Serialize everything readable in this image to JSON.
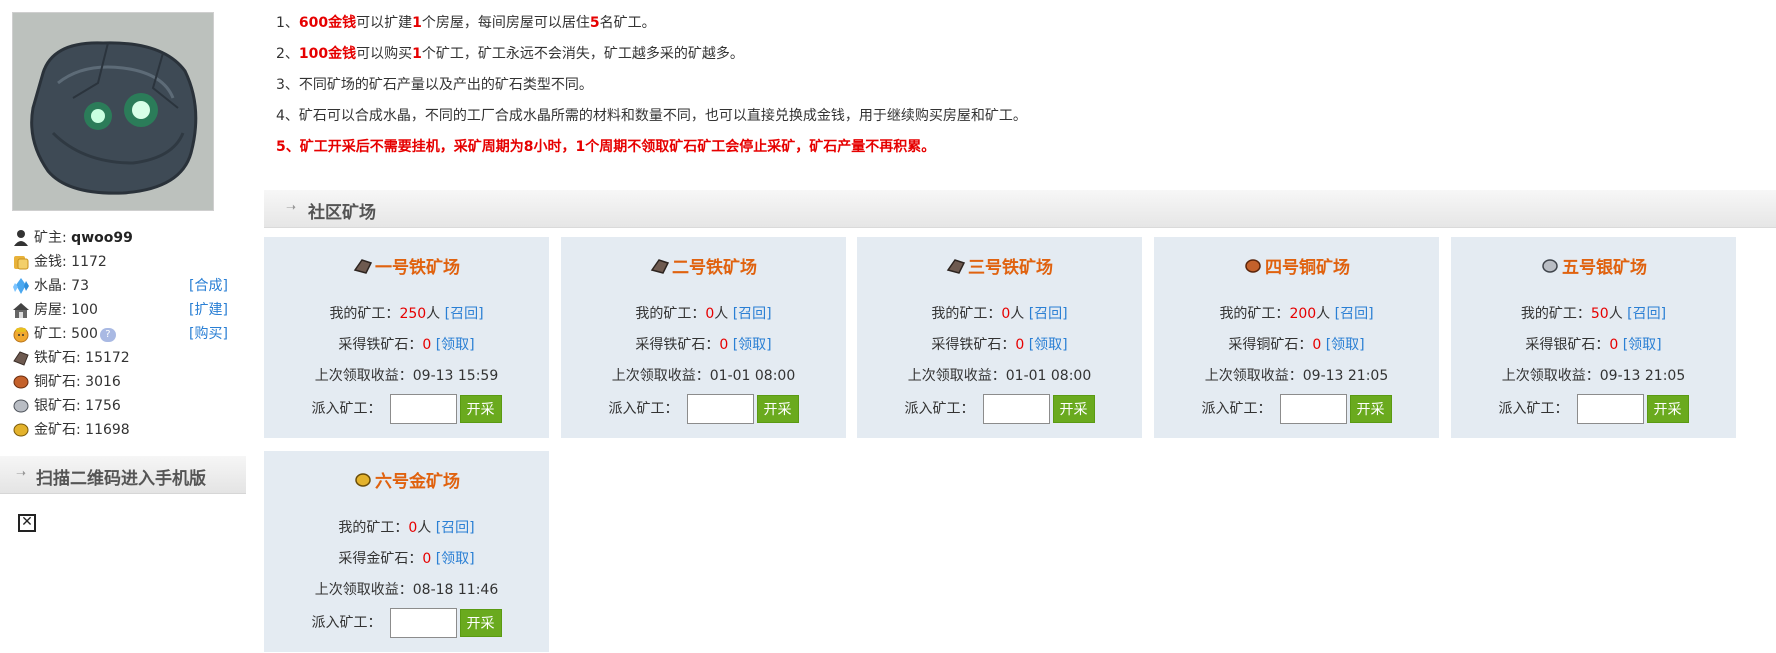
{
  "colors": {
    "accent_red": "#e60000",
    "mine_title": "#e0620f",
    "link": "#2a7fd4",
    "card_bg": "#e4ebf2",
    "start_btn": "#6aaa1e"
  },
  "sidebar": {
    "owner_label": "矿主: ",
    "owner_name": "qwoo99",
    "stats": [
      {
        "icon": "user-icon",
        "label": "矿主: qwoo99"
      },
      {
        "icon": "coins-icon",
        "label": "金钱: 1172"
      },
      {
        "icon": "crystal-icon",
        "label": "水晶: 73",
        "action": "[合成]"
      },
      {
        "icon": "house-icon",
        "label": "房屋: 100",
        "action": "[扩建]"
      },
      {
        "icon": "miner-icon",
        "label": "矿工: 500",
        "action": "[购买]"
      },
      {
        "icon": "iron-ore-icon",
        "label": "铁矿石: 15172"
      },
      {
        "icon": "copper-ore-icon",
        "label": "铜矿石: 3016"
      },
      {
        "icon": "silver-ore-icon",
        "label": "银矿石: 1756"
      },
      {
        "icon": "gold-ore-icon",
        "label": "金矿石: 11698"
      }
    ],
    "qr_title": "扫描二维码进入手机版"
  },
  "rules": {
    "r1": {
      "prefix": "1、",
      "amount": "600金钱",
      "mid": "可以扩建",
      "n1": "1",
      "mid2": "个房屋，每间房屋可以居住",
      "n2": "5",
      "suffix": "名矿工。"
    },
    "r2": {
      "prefix": "2、",
      "amount": "100金钱",
      "mid": "可以购买",
      "n1": "1",
      "suffix": "个矿工，矿工永远不会消失，矿工越多采的矿越多。"
    },
    "r3": "3、不同矿场的矿石产量以及产出的矿石类型不同。",
    "r4": "4、矿石可以合成水晶，不同的工厂合成水晶所需的材料和数量不同，也可以直接兑换成金钱，用于继续购买房屋和矿工。",
    "r5": "5、矿工开采后不需要挂机，采矿周期为8小时，1个周期不领取矿石矿工会停止采矿，矿石产量不再积累。"
  },
  "section_title": "社区矿场",
  "mine_labels": {
    "my_miners": "我的矿工：",
    "person_unit": "人",
    "recall": "[召回]",
    "collect": "[领取]",
    "last_income": "上次领取收益：",
    "assign": "派入矿工：",
    "start_btn": "开采"
  },
  "mines": [
    {
      "name": "一号铁矿场",
      "ore_icon": "iron-ore-icon",
      "miners": "250",
      "ore_label": "采得铁矿石：",
      "ore_amount": "0",
      "last_time": "09-13 15:59"
    },
    {
      "name": "二号铁矿场",
      "ore_icon": "iron-ore-icon",
      "miners": "0",
      "ore_label": "采得铁矿石：",
      "ore_amount": "0",
      "last_time": "01-01 08:00"
    },
    {
      "name": "三号铁矿场",
      "ore_icon": "iron-ore-icon",
      "miners": "0",
      "ore_label": "采得铁矿石：",
      "ore_amount": "0",
      "last_time": "01-01 08:00"
    },
    {
      "name": "四号铜矿场",
      "ore_icon": "copper-ore-icon",
      "miners": "200",
      "ore_label": "采得铜矿石：",
      "ore_amount": "0",
      "last_time": "09-13 21:05"
    },
    {
      "name": "五号银矿场",
      "ore_icon": "silver-ore-icon",
      "miners": "50",
      "ore_label": "采得银矿石：",
      "ore_amount": "0",
      "last_time": "09-13 21:05"
    },
    {
      "name": "六号金矿场",
      "ore_icon": "gold-ore-icon",
      "miners": "0",
      "ore_label": "采得金矿石：",
      "ore_amount": "0",
      "last_time": "08-18 11:46"
    }
  ]
}
